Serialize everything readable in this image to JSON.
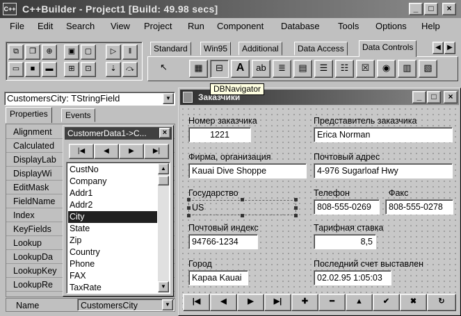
{
  "window": {
    "title": "C++Builder - Project1 [Build: 49.98 secs]",
    "min_label": "_",
    "max_label": "□",
    "close_label": "×"
  },
  "menu": [
    "File",
    "Edit",
    "Search",
    "View",
    "Project",
    "Run",
    "Component",
    "Database",
    "Tools",
    "Options",
    "Help"
  ],
  "speedbar": {
    "buttons": [
      {
        "icon": "open-project-icon",
        "glyph": "⧉"
      },
      {
        "icon": "add-file-icon",
        "glyph": "❐"
      },
      {
        "icon": "add-to-project-icon",
        "glyph": "⊕"
      },
      {
        "icon": "select-unit-icon",
        "glyph": "▣"
      },
      {
        "icon": "select-form-icon",
        "glyph": "▢"
      },
      {
        "icon": "run-icon",
        "glyph": "▷"
      },
      {
        "icon": "pause-icon",
        "glyph": "‖"
      },
      {
        "icon": "open-icon",
        "glyph": "▭"
      },
      {
        "icon": "save-icon",
        "glyph": "■"
      },
      {
        "icon": "remove-file-icon",
        "glyph": "▬"
      },
      {
        "icon": "toggle-form-icon",
        "glyph": "⊞"
      },
      {
        "icon": "new-form-icon",
        "glyph": "⊡"
      },
      {
        "icon": "trace-into-icon",
        "glyph": "⇣"
      },
      {
        "icon": "step-over-icon",
        "glyph": "⤼"
      }
    ]
  },
  "palette": {
    "tabs": [
      "Standard",
      "Win95",
      "Additional",
      "Data Access",
      "Data Controls"
    ],
    "active_tab": "Data Controls",
    "scroll_left": "◀",
    "scroll_right": "▶",
    "icons": [
      {
        "name": "pointer-icon",
        "glyph": "↖"
      },
      {
        "name": "dbgrid-icon",
        "glyph": "▦"
      },
      {
        "name": "dbnavigator-icon",
        "glyph": "⊟"
      },
      {
        "name": "dbtext-icon",
        "glyph": "A"
      },
      {
        "name": "dbedit-icon",
        "glyph": "ab"
      },
      {
        "name": "dbmemo-icon",
        "glyph": "≣"
      },
      {
        "name": "dbimage-icon",
        "glyph": "▤"
      },
      {
        "name": "dblistbox-icon",
        "glyph": "☰"
      },
      {
        "name": "dbcombobox-icon",
        "glyph": "☷"
      },
      {
        "name": "dbcheckbox-icon",
        "glyph": "☒"
      },
      {
        "name": "dbradiogroup-icon",
        "glyph": "◉"
      },
      {
        "name": "dblookuplist-icon",
        "glyph": "▥"
      },
      {
        "name": "dblookupcombo-icon",
        "glyph": "▧"
      }
    ]
  },
  "hint": "DBNavigator",
  "inspector": {
    "component": "CustomersCity: TStringField",
    "tabs": [
      "Properties",
      "Events"
    ],
    "properties": [
      "Alignment",
      "Calculated",
      "DisplayLab",
      "DisplayWi",
      "EditMask",
      "FieldName",
      "Index",
      "KeyFields",
      "Lookup",
      "LookupDa",
      "LookupKey",
      "LookupRe"
    ],
    "name_label": "Name",
    "name_value": "CustomersCity"
  },
  "fields_editor": {
    "title": "CustomerData1->C...",
    "close_label": "×",
    "nav": [
      "|◀",
      "◀",
      "▶",
      "▶|"
    ],
    "fields": [
      "CustNo",
      "Company",
      "Addr1",
      "Addr2",
      "City",
      "State",
      "Zip",
      "Country",
      "Phone",
      "FAX",
      "TaxRate"
    ],
    "selected": "City",
    "scroll_up": "▲",
    "scroll_down": "▼"
  },
  "form": {
    "title": "Заказчики",
    "labels": {
      "cust_no": "Номер заказчика",
      "rep": "Представитель заказчика",
      "company": "Фирма, организация",
      "address": "Почтовый адрес",
      "state": "Государство",
      "phone": "Телефон",
      "fax": "Факс",
      "zip": "Почтовый индекс",
      "tax": "Тарифная ставка",
      "city": "Город",
      "last_invoice": "Последний счет выставлен"
    },
    "values": {
      "cust_no": "1221",
      "rep": "Erica Norman",
      "company": "Kauai Dive Shoppe",
      "address": "4-976 Sugarloaf Hwy",
      "state": "US",
      "phone": "808-555-0269",
      "fax": "808-555-0278",
      "zip": "94766-1234",
      "tax": "8,5",
      "city": "Kapaa Kauai",
      "last_invoice": "02.02.95 1:05:03"
    },
    "navigator": [
      {
        "name": "first-record-button",
        "glyph": "|◀"
      },
      {
        "name": "prior-record-button",
        "glyph": "◀"
      },
      {
        "name": "next-record-button",
        "glyph": "▶"
      },
      {
        "name": "last-record-button",
        "glyph": "▶|"
      },
      {
        "name": "insert-record-button",
        "glyph": "✚"
      },
      {
        "name": "delete-record-button",
        "glyph": "━"
      },
      {
        "name": "edit-record-button",
        "glyph": "▲"
      },
      {
        "name": "post-record-button",
        "glyph": "✔"
      },
      {
        "name": "cancel-record-button",
        "glyph": "✖"
      },
      {
        "name": "refresh-record-button",
        "glyph": "↻"
      }
    ]
  }
}
